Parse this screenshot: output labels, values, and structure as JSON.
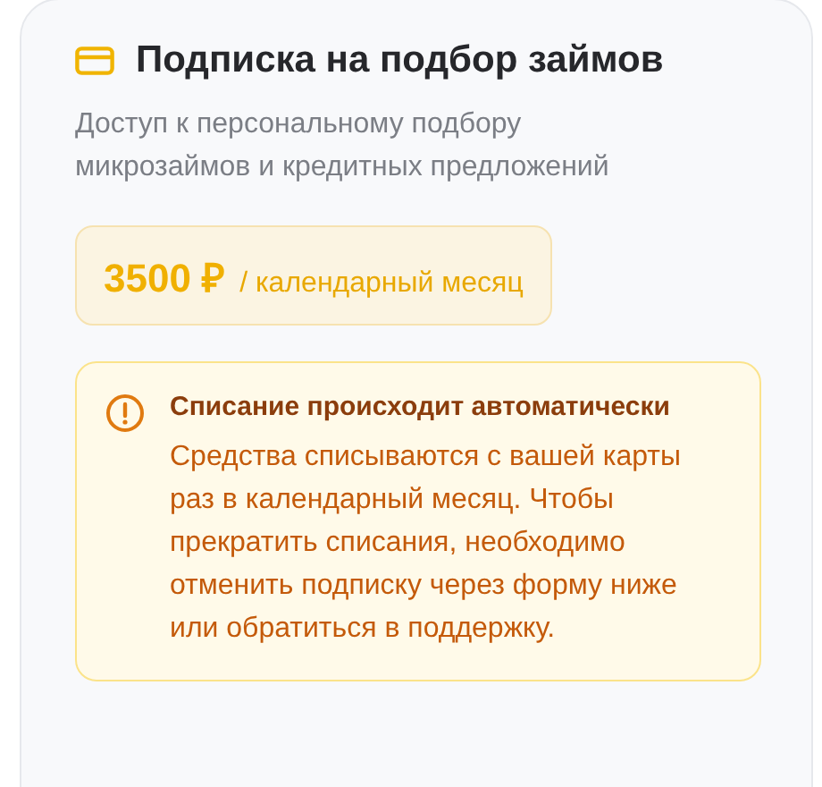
{
  "card": {
    "title": "Подписка на подбор займов",
    "description": "Доступ к персональному подбору микрозаймов и кредитных предложений",
    "price": {
      "amount": "3500 ₽",
      "period": "/ календарный месяц"
    },
    "notice": {
      "kind": "warning",
      "title": "Списание происходит автоматически",
      "text": "Средства списываются с вашей карты раз в календарный месяц. Чтобы прекратить списания, необходимо отменить подписку через форму ниже или обратиться в поддержку."
    }
  }
}
